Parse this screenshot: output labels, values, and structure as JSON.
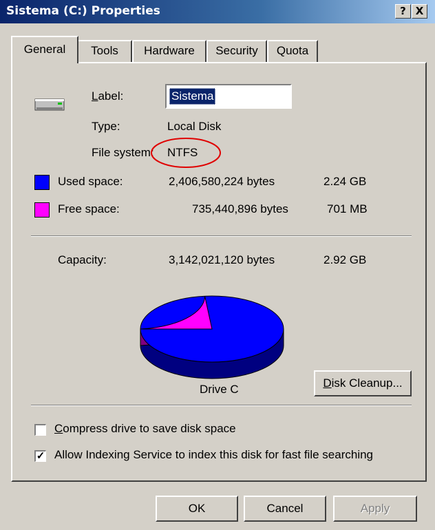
{
  "window": {
    "title": "Sistema (C:) Properties",
    "help_label": "?",
    "close_label": "X"
  },
  "tabs": [
    {
      "label": "General",
      "active": true
    },
    {
      "label": "Tools",
      "active": false
    },
    {
      "label": "Hardware",
      "active": false
    },
    {
      "label": "Security",
      "active": false
    },
    {
      "label": "Quota",
      "active": false
    }
  ],
  "drive": {
    "label_caption": "Label:",
    "label_value": "Sistema",
    "type_caption": "Type:",
    "type_value": "Local Disk",
    "fs_caption": "File system:",
    "fs_value": "NTFS"
  },
  "space": {
    "used": {
      "caption": "Used space:",
      "bytes": "2,406,580,224 bytes",
      "size": "2.24 GB",
      "color": "#0000ff"
    },
    "free": {
      "caption": "Free space:",
      "bytes": "735,440,896 bytes",
      "size": "701 MB",
      "color": "#ff00ff"
    },
    "capacity": {
      "caption": "Capacity:",
      "bytes": "3,142,021,120 bytes",
      "size": "2.92 GB"
    },
    "used_fraction": 0.766
  },
  "chart": {
    "label": "Drive C"
  },
  "buttons": {
    "disk_cleanup": "Disk Cleanup...",
    "ok": "OK",
    "cancel": "Cancel",
    "apply": "Apply"
  },
  "options": {
    "compress": {
      "label": "Compress drive to save disk space",
      "checked": false
    },
    "indexing": {
      "label": "Allow Indexing Service to index this disk for fast file searching",
      "checked": true
    }
  },
  "annotation": {
    "color": "#e00000"
  }
}
